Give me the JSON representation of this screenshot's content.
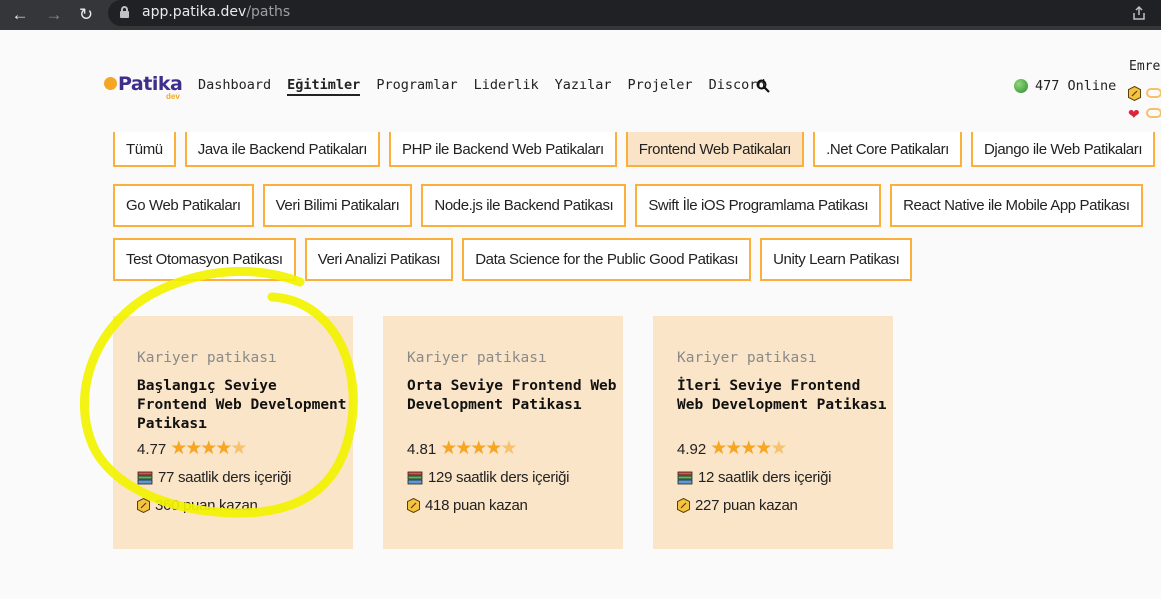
{
  "browser": {
    "url_host": "app.patika.dev",
    "url_path": "/paths",
    "back_icon": "arrow-left-icon",
    "forward_icon": "arrow-right-icon",
    "reload_icon": "reload-icon"
  },
  "header": {
    "logo_text": "Patika",
    "logo_sub": "dev",
    "nav": [
      "Dashboard",
      "Eğitimler",
      "Programlar",
      "Liderlik",
      "Yazılar",
      "Projeler",
      "Discord"
    ],
    "active_nav": "Eğitimler",
    "online_text": "477 Online",
    "user_name": "Emre"
  },
  "filters": {
    "row1": [
      "Tümü",
      "Java ile Backend Patikaları",
      "PHP ile Backend Web Patikaları",
      "Frontend Web Patikaları",
      ".Net Core Patikaları",
      "Django ile Web Patikaları"
    ],
    "row2": [
      "Go Web Patikaları",
      "Veri Bilimi Patikaları",
      "Node.js ile Backend Patikası",
      "Swift İle iOS Programlama Patikası",
      "React Native ile Mobile App Patikası"
    ],
    "row3": [
      "Test Otomasyon Patikası",
      "Veri Analizi Patikası",
      "Data Science for the Public Good Patikası",
      "Unity Learn Patikası"
    ],
    "selected": "Frontend Web Patikaları"
  },
  "cards": [
    {
      "kind": "Kariyer patikası",
      "title": "Başlangıç Seviye Frontend Web Development Patikası",
      "rating": "4.77",
      "rating_value": 4.77,
      "hours": "77 saatlik ders içeriği",
      "points": "360 puan kazan"
    },
    {
      "kind": "Kariyer patikası",
      "title": "Orta Seviye Frontend Web Development Patikası",
      "rating": "4.81",
      "rating_value": 4.81,
      "hours": "129 saatlik ders içeriği",
      "points": "418 puan kazan"
    },
    {
      "kind": "Kariyer patikası",
      "title": "İleri Seviye Frontend Web Development Patikası",
      "rating": "4.92",
      "rating_value": 4.92,
      "hours": "12 saatlik ders içeriği",
      "points": "227 puan kazan"
    }
  ],
  "colors": {
    "accent": "#fbb03b",
    "card_bg": "#fae5c8",
    "brand": "#3f2d8c",
    "annotation": "#f5f500"
  }
}
